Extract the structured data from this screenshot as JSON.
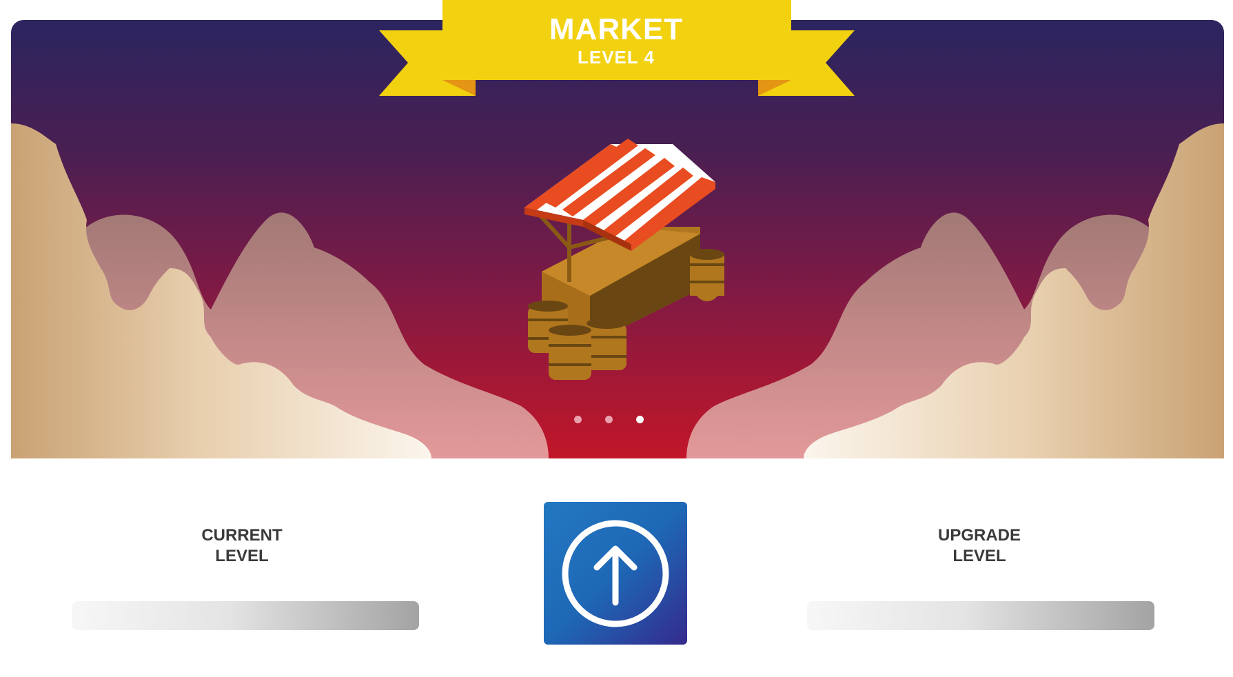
{
  "building": {
    "name": "MARKET",
    "level_label": "LEVEL 4"
  },
  "carousel": {
    "page_count": 3,
    "active_index": 2
  },
  "stats": {
    "current_label_line1": "CURRENT",
    "current_label_line2": "LEVEL",
    "upgrade_label_line1": "UPGRADE",
    "upgrade_label_line2": "LEVEL"
  },
  "upgrade_button": {
    "icon": "arrow-up-circle-icon"
  },
  "colors": {
    "banner": "#f2d110",
    "banner_fold": "#e39513",
    "sky_top": "#2b2560",
    "sky_bottom": "#c21628",
    "button_blue": "#2378c2",
    "button_indigo": "#342a8c",
    "awning_red": "#e84c20"
  }
}
